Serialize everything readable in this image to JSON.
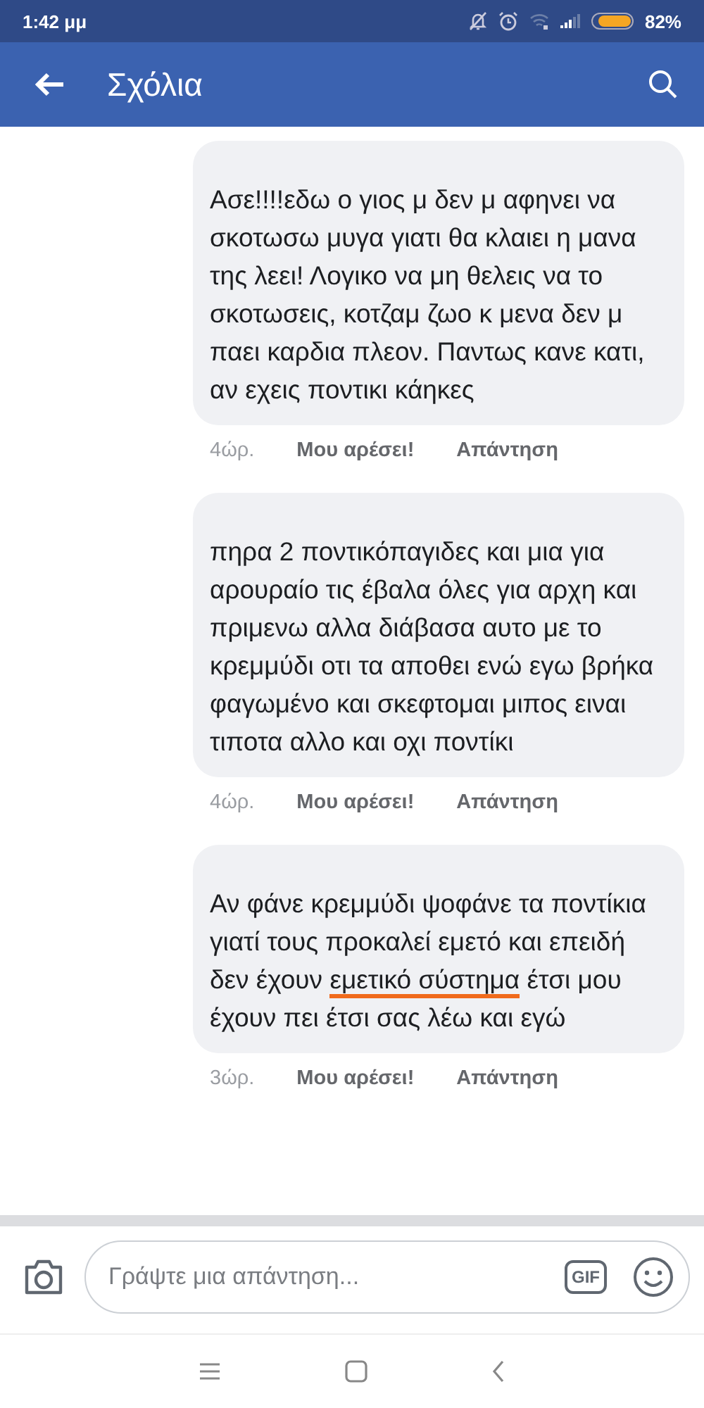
{
  "status_bar": {
    "time": "1:42 μμ",
    "battery": "82%"
  },
  "header": {
    "title": "Σχόλια"
  },
  "comments": [
    {
      "body": [
        {
          "text": "Ασε!!!!εδω ο γιος μ δεν μ αφηνει να σκοτωσω μυγα γιατι θα κλαιει η μανα της λεει! Λογικο να μη θελεις να το σκοτωσεις, κοτζαμ ζωο κ μενα δεν μ παει καρδια πλεον. Παντως κανε κατι, αν εχεις ποντικι κάηκες",
          "underlined": false
        }
      ],
      "time": "4ώρ.",
      "like": "Μου αρέσει!",
      "reply": "Απάντηση"
    },
    {
      "body": [
        {
          "text": "πηρα 2 ποντικόπαγιδες και μια για αρουραίο τις έβαλα όλες για αρχη και πριμενω αλλα διάβασα αυτο με το κρεμμύδι οτι τα αποθει ενώ εγω βρήκα φαγωμένο και σκεφτομαι μιπος ειναι τιποτα αλλο και οχι ποντίκι",
          "underlined": false
        }
      ],
      "time": "4ώρ.",
      "like": "Μου αρέσει!",
      "reply": "Απάντηση"
    },
    {
      "body": [
        {
          "text": "Αν φάνε κρεμμύδι ψοφάνε τα ποντίκια γιατί τους προκαλεί εμετό και επειδή δεν έχουν ",
          "underlined": false
        },
        {
          "text": "εμετικό σύστημα",
          "underlined": true
        },
        {
          "text": " έτσι μου έχουν πει έτσι σας λέω και εγώ",
          "underlined": false
        }
      ],
      "time": "3ώρ.",
      "like": "Μου αρέσει!",
      "reply": "Απάντηση"
    }
  ],
  "composer": {
    "placeholder": "Γράψτε μια απάντηση...",
    "gif": "GIF"
  }
}
